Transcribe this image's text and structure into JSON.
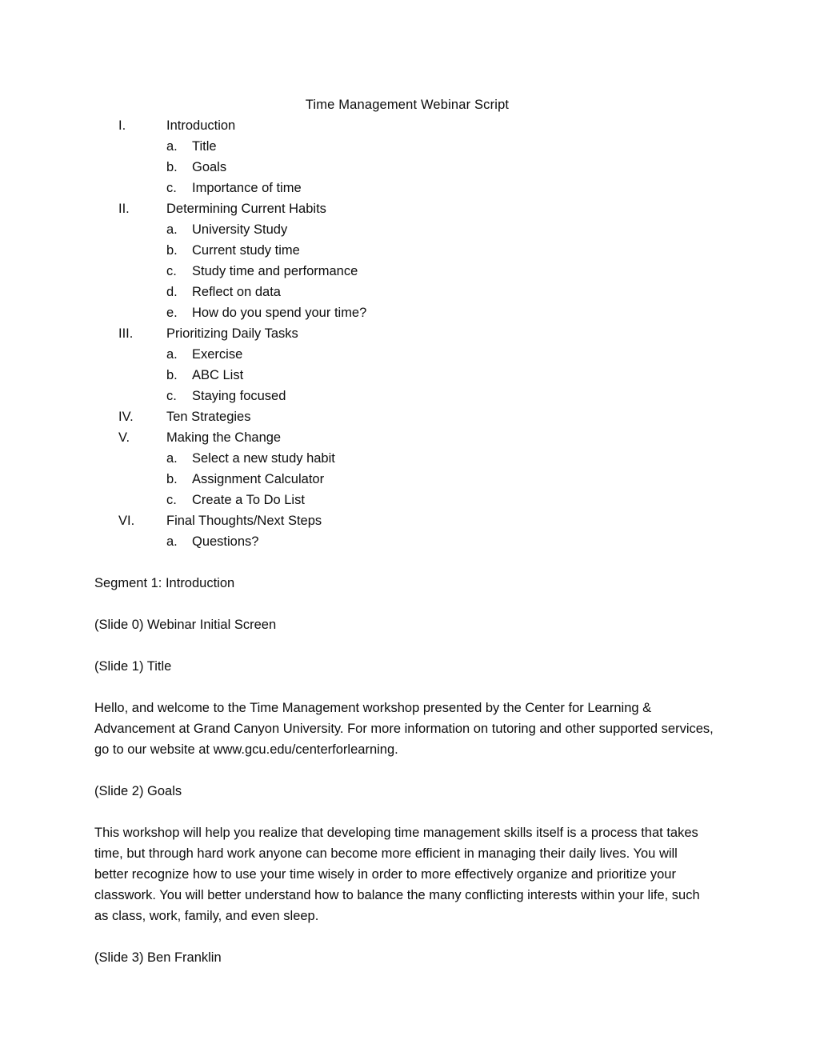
{
  "document": {
    "title": "Time Management Webinar Script",
    "outline": [
      {
        "level": 1,
        "marker": "I.",
        "text": "Introduction"
      },
      {
        "level": 2,
        "marker": "a.",
        "text": "Title"
      },
      {
        "level": 2,
        "marker": "b.",
        "text": "Goals"
      },
      {
        "level": 2,
        "marker": "c.",
        "text": "Importance of time"
      },
      {
        "level": 1,
        "marker": "II.",
        "text": "Determining Current Habits"
      },
      {
        "level": 2,
        "marker": "a.",
        "text": "University Study"
      },
      {
        "level": 2,
        "marker": "b.",
        "text": "Current study time"
      },
      {
        "level": 2,
        "marker": "c.",
        "text": "Study time and performance"
      },
      {
        "level": 2,
        "marker": "d.",
        "text": "Reflect on data"
      },
      {
        "level": 2,
        "marker": "e.",
        "text": "How do you spend your time?"
      },
      {
        "level": 1,
        "marker": "III.",
        "text": "Prioritizing Daily Tasks"
      },
      {
        "level": 2,
        "marker": "a.",
        "text": "Exercise"
      },
      {
        "level": 2,
        "marker": "b.",
        "text": "ABC List"
      },
      {
        "level": 2,
        "marker": "c.",
        "text": "Staying focused"
      },
      {
        "level": 1,
        "marker": "IV.",
        "text": "Ten Strategies"
      },
      {
        "level": 1,
        "marker": "V.",
        "text": "Making the Change"
      },
      {
        "level": 2,
        "marker": "a.",
        "text": "Select a new study habit"
      },
      {
        "level": 2,
        "marker": "b.",
        "text": "Assignment Calculator"
      },
      {
        "level": 2,
        "marker": "c.",
        "text": "Create a To Do List"
      },
      {
        "level": 1,
        "marker": "VI.",
        "text": "Final Thoughts/Next Steps"
      },
      {
        "level": 2,
        "marker": "a.",
        "text": "Questions?"
      }
    ],
    "body": [
      {
        "id": "segment-heading",
        "text": "Segment 1: Introduction"
      },
      {
        "id": "slide-0-heading",
        "text": "(Slide 0) Webinar Initial Screen"
      },
      {
        "id": "slide-1-heading",
        "text": "(Slide 1) Title"
      },
      {
        "id": "slide-1-paragraph",
        "text": "Hello, and welcome to the Time Management workshop presented by the Center for Learning & Advancement at Grand Canyon University.  For more information on tutoring and other supported services, go to our website at www.gcu.edu/centerforlearning."
      },
      {
        "id": "slide-2-heading",
        "text": "(Slide 2) Goals"
      },
      {
        "id": "slide-2-paragraph",
        "text": "This workshop will help you realize that developing time management skills itself is a process that takes time, but through hard work anyone can become more efficient in managing their daily lives.  You will better recognize how to use your time wisely in order to more effectively organize and prioritize your classwork.  You will better understand how to balance the many conflicting interests within your life, such as class, work, family, and even sleep."
      },
      {
        "id": "slide-3-heading",
        "text": "(Slide 3) Ben Franklin"
      }
    ]
  }
}
